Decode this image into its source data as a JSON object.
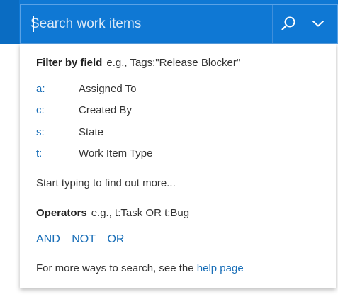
{
  "search": {
    "placeholder": "Search work items",
    "value": ""
  },
  "filter_section": {
    "title": "Filter by field",
    "example": "e.g., Tags:\"Release Blocker\"",
    "fields": [
      {
        "key": "a:",
        "label": "Assigned To"
      },
      {
        "key": "c:",
        "label": "Created By"
      },
      {
        "key": "s:",
        "label": "State"
      },
      {
        "key": "t:",
        "label": "Work Item Type"
      }
    ]
  },
  "hint": "Start typing to find out more...",
  "operators_section": {
    "title": "Operators",
    "example": "e.g., t:Task OR t:Bug",
    "operators": [
      "AND",
      "NOT",
      "OR"
    ]
  },
  "footer": {
    "text": "For more ways to search, see the",
    "link_label": "help page"
  },
  "icons": {
    "search": "search-icon",
    "dropdown": "chevron-down-icon"
  },
  "colors": {
    "header_bg": "#0f78d4",
    "link": "#1a6fb8",
    "text": "#333333"
  }
}
